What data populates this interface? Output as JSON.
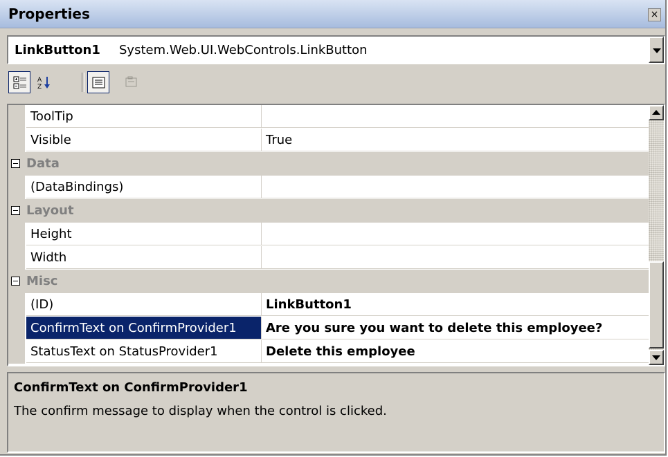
{
  "window": {
    "title": "Properties",
    "close_label": "×"
  },
  "object_selector": {
    "name": "LinkButton1",
    "type": "System.Web.UI.WebControls.LinkButton"
  },
  "toolbar": {
    "buttons": [
      {
        "icon": "categorized-icon",
        "pressed": true
      },
      {
        "icon": "alphabetical-icon",
        "pressed": false
      },
      {
        "icon": "properties-icon",
        "pressed": true
      },
      {
        "icon": "property-pages-icon",
        "pressed": false
      }
    ]
  },
  "grid": {
    "rows": [
      {
        "name": "ToolTip",
        "value": ""
      },
      {
        "name": "Visible",
        "value": "True"
      },
      {
        "category": "Data"
      },
      {
        "name": "(DataBindings)",
        "value": ""
      },
      {
        "category": "Layout"
      },
      {
        "name": "Height",
        "value": ""
      },
      {
        "name": "Width",
        "value": ""
      },
      {
        "category": "Misc"
      },
      {
        "name": "(ID)",
        "value": "LinkButton1",
        "bold": true
      },
      {
        "name": "ConfirmText on ConfirmProvider1",
        "value": "Are you sure you want to delete this employee?",
        "bold": true,
        "selected": true
      },
      {
        "name": "StatusText on StatusProvider1",
        "value": "Delete this employee",
        "bold": true
      }
    ]
  },
  "description": {
    "title": "ConfirmText on ConfirmProvider1",
    "text": "The confirm message to display when the control is clicked."
  },
  "colors": {
    "selection": "#0a246a",
    "panel": "#d4d0c8",
    "category_text": "#808080"
  }
}
